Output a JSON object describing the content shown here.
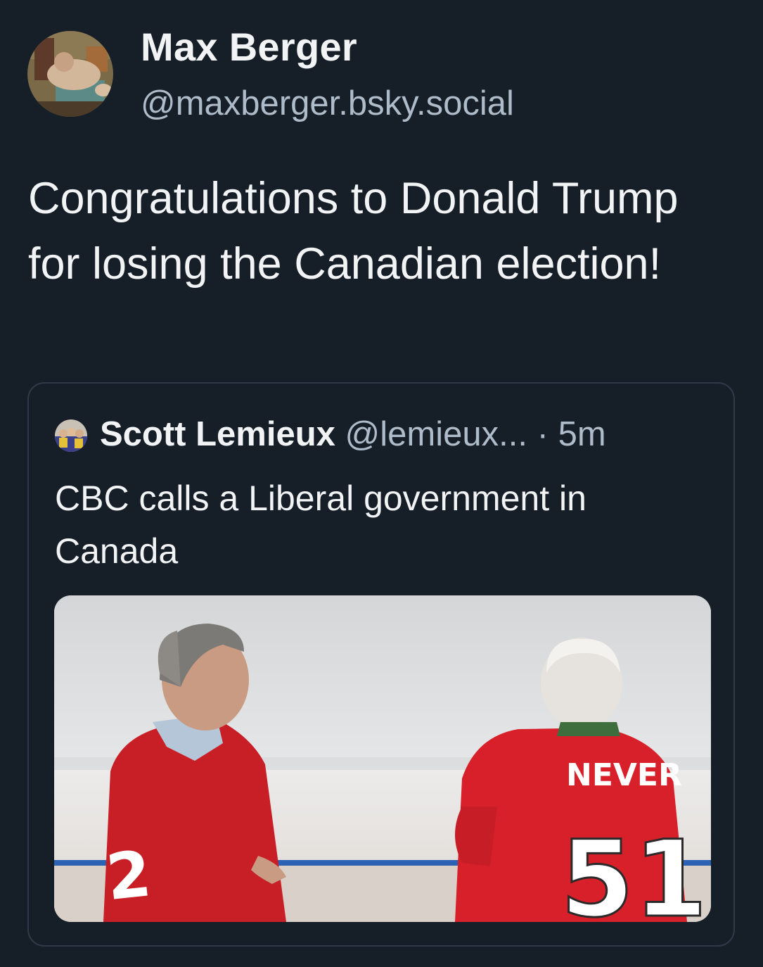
{
  "post": {
    "author": {
      "display_name": "Max Berger",
      "handle": "@maxberger.bsky.social",
      "avatar_icon": "painting-avatar-icon"
    },
    "text": "Congratulations to Donald Trump for losing the Canadian election!"
  },
  "quote": {
    "author": {
      "display_name": "Scott Lemieux",
      "handle": "@lemieux...",
      "avatar_icon": "group-photo-avatar-icon"
    },
    "separator": "·",
    "time": "5m",
    "text": "CBC calls a Liberal government in Canada",
    "image": {
      "jersey_word": "NEVER",
      "jersey_number": "51"
    }
  },
  "colors": {
    "background": "#161e27",
    "text_primary": "#f1f3f5",
    "text_secondary": "#aebbc9",
    "card_border": "#2e3a48",
    "jersey_red": "#d8202a"
  }
}
